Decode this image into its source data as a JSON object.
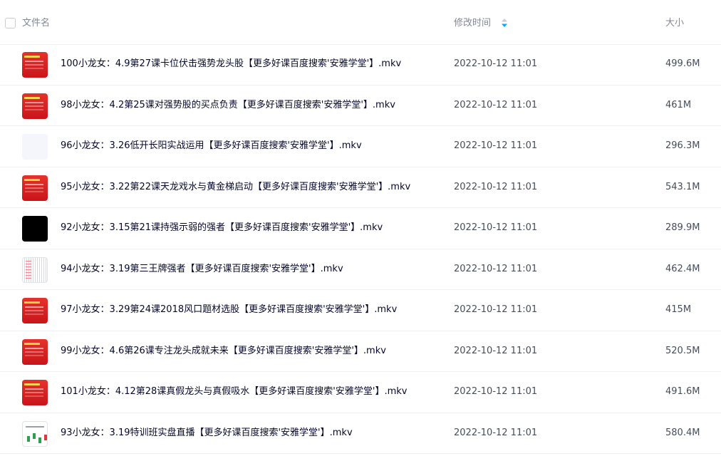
{
  "header": {
    "col_name": "文件名",
    "col_time": "修改时间",
    "col_size": "大小",
    "sort_icon": "sort-arrows-icon"
  },
  "files": [
    {
      "name": "100小龙女：4.9第27课卡位伏击强势龙头股【更多好课百度搜索'安雅学堂'】.mkv",
      "time": "2022-10-12 11:01",
      "size": "499.6M",
      "thumb": "red"
    },
    {
      "name": "98小龙女：4.2第25课对强势股的买点负责【更多好课百度搜索'安雅学堂'】.mkv",
      "time": "2022-10-12 11:01",
      "size": "461M",
      "thumb": "red"
    },
    {
      "name": "96小龙女：3.26低开长阳实战运用【更多好课百度搜索'安雅学堂'】.mkv",
      "time": "2022-10-12 11:01",
      "size": "296.3M",
      "thumb": "blank"
    },
    {
      "name": "95小龙女：3.22第22课天龙戏水与黄金梯启动【更多好课百度搜索'安雅学堂'】.mkv",
      "time": "2022-10-12 11:01",
      "size": "543.1M",
      "thumb": "red"
    },
    {
      "name": "92小龙女：3.15第21课持强示弱的强者【更多好课百度搜索'安雅学堂'】.mkv",
      "time": "2022-10-12 11:01",
      "size": "289.9M",
      "thumb": "black"
    },
    {
      "name": "94小龙女：3.19第三王牌强者【更多好课百度搜索'安雅学堂'】.mkv",
      "time": "2022-10-12 11:01",
      "size": "462.4M",
      "thumb": "grid"
    },
    {
      "name": "97小龙女：3.29第24课2018风口题材选股【更多好课百度搜索'安雅学堂'】.mkv",
      "time": "2022-10-12 11:01",
      "size": "415M",
      "thumb": "red"
    },
    {
      "name": "99小龙女：4.6第26课专注龙头成就未来【更多好课百度搜索'安雅学堂'】.mkv",
      "time": "2022-10-12 11:01",
      "size": "520.5M",
      "thumb": "red"
    },
    {
      "name": "101小龙女：4.12第28课真假龙头与真假吸水【更多好课百度搜索'安雅学堂'】.mkv",
      "time": "2022-10-12 11:01",
      "size": "491.6M",
      "thumb": "red"
    },
    {
      "name": "93小龙女：3.19特训班实盘直播【更多好课百度搜索'安雅学堂'】.mkv",
      "time": "2022-10-12 11:01",
      "size": "580.4M",
      "thumb": "chart"
    }
  ],
  "colors": {
    "accent": "#06a7ff",
    "header_text": "#828893",
    "name_text": "#05082c",
    "meta_text": "#454d5a",
    "divider": "#eef0f4"
  }
}
